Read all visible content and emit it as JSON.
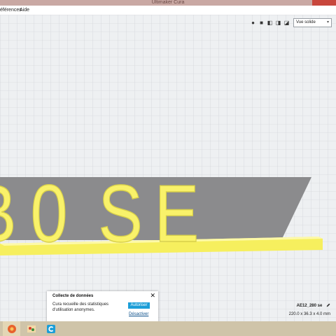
{
  "window": {
    "title": "Ultimaker Cura"
  },
  "menu": {
    "items": [
      "éférences",
      "Aide"
    ]
  },
  "view": {
    "selected": "Vue solide"
  },
  "model": {
    "text": [
      "B",
      "0",
      "S",
      "E"
    ]
  },
  "popup": {
    "title": "Collecte de données",
    "body": "Cura recueille des statistiques d'utilisation anonymes.",
    "allow": "Autoriser",
    "deny": "Désactiver"
  },
  "print": {
    "name": "AE12_280 se",
    "dimensions": "220.0 x 36.3 x 4.0 mm"
  },
  "colors": {
    "model": "#f9f26a",
    "build_plate": "#eef0f2",
    "accent": "#1c9ed8"
  }
}
